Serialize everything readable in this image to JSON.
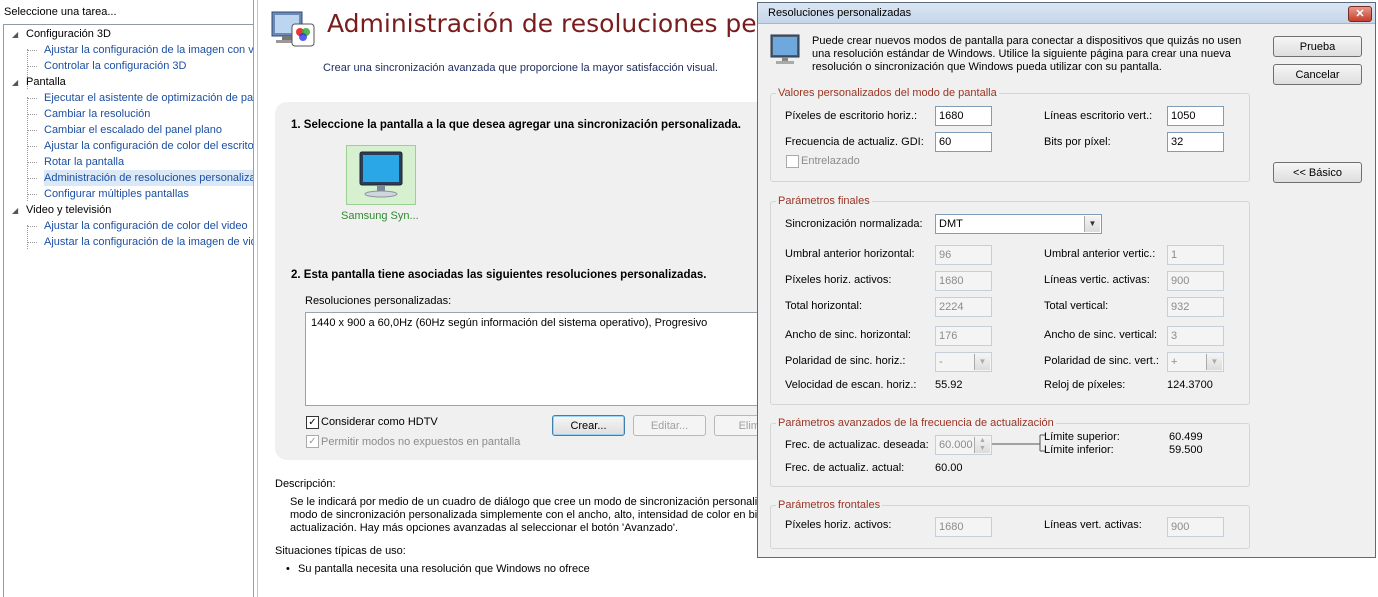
{
  "task_panel": {
    "header": "Seleccione una tarea...",
    "tree": [
      {
        "label": "Configuración 3D",
        "type": "category"
      },
      {
        "label": "Ajustar la configuración de la imagen con v",
        "type": "item"
      },
      {
        "label": "Controlar la configuración 3D",
        "type": "item"
      },
      {
        "label": "Pantalla",
        "type": "category"
      },
      {
        "label": "Ejecutar el asistente de optimización de pa",
        "type": "item"
      },
      {
        "label": "Cambiar la resolución",
        "type": "item"
      },
      {
        "label": "Cambiar el escalado del panel plano",
        "type": "item"
      },
      {
        "label": "Ajustar la configuración de color del escrito",
        "type": "item"
      },
      {
        "label": "Rotar la pantalla",
        "type": "item"
      },
      {
        "label": "Administración de resoluciones personalizad",
        "type": "item",
        "selected": true
      },
      {
        "label": "Configurar múltiples pantallas",
        "type": "item"
      },
      {
        "label": "Video y televisión",
        "type": "category"
      },
      {
        "label": "Ajustar la configuración de color del video",
        "type": "item"
      },
      {
        "label": "Ajustar la configuración de la imagen de vid",
        "type": "item"
      }
    ]
  },
  "main": {
    "title": "Administración de resoluciones personaliza",
    "subtitle": "Crear una sincronización avanzada que proporcione la mayor satisfacción visual.",
    "step1": "1. Seleccione la pantalla a la que desea agregar una sincronización personalizada.",
    "monitor_name": "Samsung Syn...",
    "step2": "2. Esta pantalla tiene asociadas las siguientes resoluciones personalizadas.",
    "list_label": "Resoluciones personalizadas:",
    "list_items": [
      "1440 x 900 a 60,0Hz (60Hz según información del sistema operativo), Progresivo"
    ],
    "hdtv_label": "Considerar como HDTV",
    "hdtv_checked": true,
    "nonexposed_label": "Permitir modos no expuestos en pantalla",
    "nonexposed_checked": true,
    "create_button": "Crear...",
    "edit_button": "Editar...",
    "delete_button": "Elimi",
    "description_header": "Descripción:",
    "description_lines": [
      "Se le indicará por medio de un cuadro de diálogo que cree un modo de sincronización personalizad",
      "modo de sincronización personalizada simplemente con el ancho, alto, intensidad de color en bits y",
      "actualización. Hay más opciones avanzadas al seleccionar el botón 'Avanzado'."
    ],
    "usage_header": "Situaciones típicas de uso:",
    "usage_bullet": "Su pantalla necesita una resolución que Windows no ofrece"
  },
  "dialog": {
    "title": "Resoluciones personalizadas",
    "close": "✕",
    "intro_lines": [
      "Puede crear nuevos modos de pantalla para conectar a dispositivos que quizás no usen",
      "una resolución estándar de Windows. Utilice la siguiente página para crear una nueva",
      "resolución o sincronización que Windows pueda utilizar con su pantalla."
    ],
    "buttons": {
      "test": "Prueba",
      "cancel": "Cancelar",
      "basic": "<< Básico"
    },
    "group_custom": {
      "label": "Valores personalizados del modo de pantalla",
      "h_pixels_label": "Píxeles de escritorio horiz.:",
      "h_pixels": "1680",
      "v_lines_label": "Líneas escritorio vert.:",
      "v_lines": "1050",
      "refresh_label": "Frecuencia de actualiz. GDI:",
      "refresh": "60",
      "bpp_label": "Bits por píxel:",
      "bpp": "32",
      "interlaced_label": "Entrelazado",
      "interlaced": false
    },
    "group_final": {
      "label": "Parámetros finales",
      "timing_label": "Sincronización normalizada:",
      "timing": "DMT",
      "rows": [
        {
          "l1": "Umbral anterior horizontal:",
          "v1": "96",
          "l2": "Umbral anterior vertic.:",
          "v2": "1"
        },
        {
          "l1": "Píxeles horiz. activos:",
          "v1": "1680",
          "l2": "Líneas vertic. activas:",
          "v2": "900"
        },
        {
          "l1": "Total horizontal:",
          "v1": "2224",
          "l2": "Total vertical:",
          "v2": "932"
        },
        {
          "l1": "Ancho de sinc. horizontal:",
          "v1": "176",
          "l2": "Ancho de sinc. vertical:",
          "v2": "3"
        }
      ],
      "h_polarity_label": "Polaridad de sinc. horiz.:",
      "h_polarity": "-",
      "v_polarity_label": "Polaridad de sinc. vert.:",
      "v_polarity": "+",
      "h_scan_label": "Velocidad de escan. horiz.:",
      "h_scan": "55.92",
      "pixel_clock_label": "Reloj de píxeles:",
      "pixel_clock": "124.3700"
    },
    "group_advanced": {
      "label": "Parámetros avanzados de la frecuencia de actualización",
      "desired_label": "Frec. de actualizac. deseada:",
      "desired": "60.000",
      "upper_label": "Límite superior:",
      "upper": "60.499",
      "lower_label": "Límite inferior:",
      "lower": "59.500",
      "actual_label": "Frec. de actualiz. actual:",
      "actual": "60.00"
    },
    "group_front": {
      "label": "Parámetros frontales",
      "h_active_label": "Píxeles horiz. activos:",
      "h_active": "1680",
      "v_active_label": "Líneas vert. activas:",
      "v_active": "900"
    }
  }
}
